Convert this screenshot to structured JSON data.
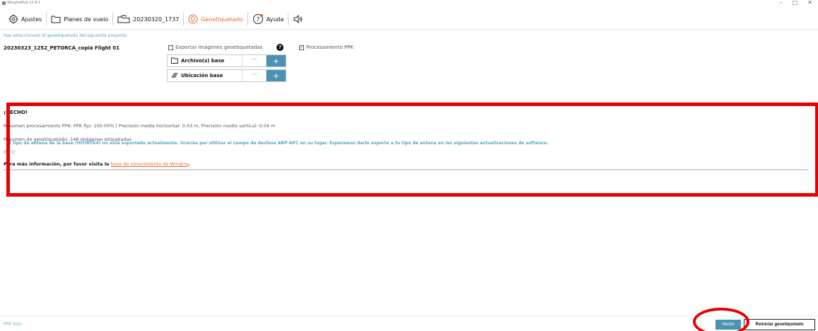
{
  "window": {
    "title": "WingtraHub v2.8.1",
    "controls": [
      "–",
      "□",
      "✕"
    ]
  },
  "nav": {
    "items": [
      {
        "label": "Ajustes",
        "icon": "gear-icon"
      },
      {
        "label": "Planes de vuelo",
        "icon": "folder-icon"
      },
      {
        "label": "20230320_1737",
        "icon": "flight-folder-icon"
      },
      {
        "label": "Geoetiquetado",
        "icon": "location-pin-icon",
        "active": true
      },
      {
        "label": "Ayuda",
        "icon": "help-icon"
      },
      {
        "label": "",
        "icon": "speaker-icon"
      }
    ]
  },
  "project": {
    "selected_info": "Has seleccionado el geoetiquetado del siguiente proyecto:",
    "name": "20230323_1252_PETORCA_copia Flight 01",
    "export_label": "Exportar imágenes geoetiquetadas",
    "export_checked": false,
    "ppk_label": "Procesamiento PPK",
    "ppk_checked": true,
    "base_files_label": "Archivo(s) base",
    "base_location_label": "Ubicación base"
  },
  "result": {
    "done": "¡HECHO!",
    "ppk_summary": "Resumen procesamiento PPK: PPK fijo: 100.00% | Precisión media horizontal: 0.03 m, Precisión media vertical: 0.04 m",
    "geo_summary": "Resumen de geoetiquetado: 148 imágenes etiquetadas.",
    "info_heading": "INFO:",
    "info_text": "- El tipo de antena de la base (HITIRTK4) no está soportado actualmente. Gracias por utilizar el campo de desfase ARP-APC en su lugar. Esperamos darle soporte a tu tipo de antena en las siguientes actualizaciones de software.",
    "more_prefix": "Para más información, por favor visita la",
    "more_link": "base de conocimiento de Wingtra",
    "more_suffix": "."
  },
  "footer": {
    "status": "PPK listo",
    "done_button": "Hecho",
    "reset_button": "Reiniciar geoetiquetado"
  },
  "colors": {
    "accent_orange": "#e86a2c",
    "accent_blue": "#4a93b3",
    "info_blue": "#54a6c9",
    "status_green": "#69c48a",
    "annotation_red": "#e60000"
  }
}
